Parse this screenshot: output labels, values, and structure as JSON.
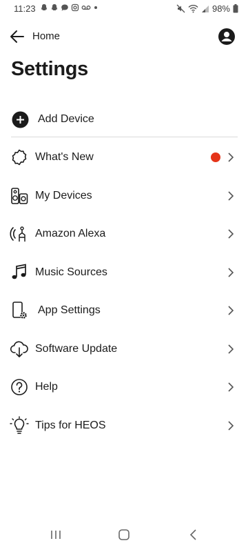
{
  "status": {
    "time": "11:23",
    "battery": "98%",
    "left_icons": [
      "snapchat-icon",
      "snapchat-icon",
      "chat-icon",
      "instagram-icon",
      "voicemail-icon",
      "dot-icon"
    ],
    "right_icons": [
      "mute-icon",
      "wifi-icon",
      "signal-icon",
      "battery-icon"
    ]
  },
  "header": {
    "back_label": "Home",
    "account_icon": "account-icon"
  },
  "page_title": "Settings",
  "add_device": {
    "label": "Add Device",
    "icon": "plus-circle-icon"
  },
  "menu": {
    "items": [
      {
        "label": "What's New",
        "icon": "badge-icon",
        "has_badge": true
      },
      {
        "label": "My Devices",
        "icon": "speakers-icon"
      },
      {
        "label": "Amazon Alexa",
        "icon": "alexa-icon"
      },
      {
        "label": "Music Sources",
        "icon": "music-note-icon"
      },
      {
        "label": "App Settings",
        "icon": "phone-gear-icon"
      },
      {
        "label": "Software Update",
        "icon": "cloud-download-icon"
      },
      {
        "label": "Help",
        "icon": "help-icon"
      },
      {
        "label": "Tips for HEOS",
        "icon": "lightbulb-icon"
      }
    ]
  },
  "colors": {
    "badge": "#e53419",
    "text": "#1b1b1b",
    "divider": "#d9d9d9"
  },
  "nav": {
    "buttons": [
      "recents-icon",
      "home-button-icon",
      "back-nav-icon"
    ]
  }
}
